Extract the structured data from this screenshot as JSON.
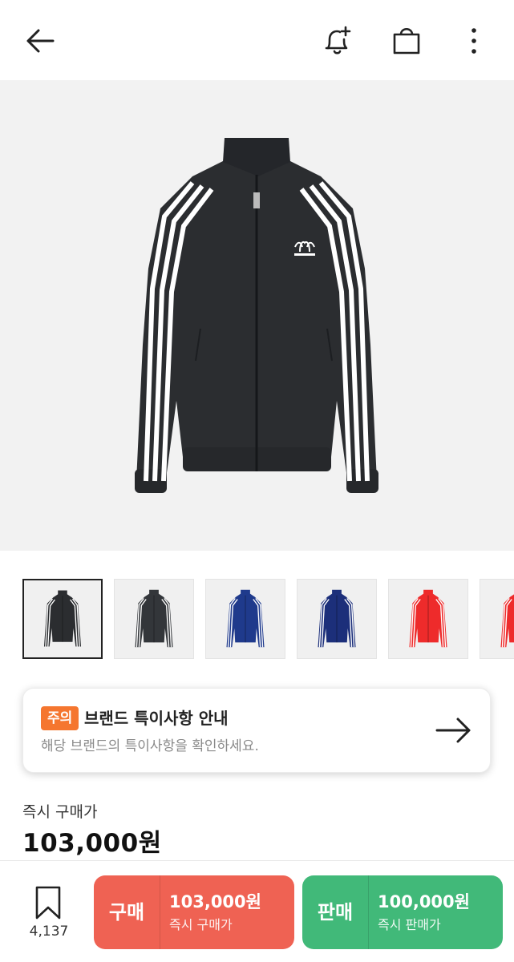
{
  "header": {
    "back_icon": "arrow-left-icon",
    "alert_icon": "bell-plus-icon",
    "cart_icon": "shopping-bag-icon",
    "more_icon": "more-vertical-icon"
  },
  "product_image": {
    "color": "#2b2d30",
    "stripe_color": "#ffffff",
    "background": "#f2f2f2"
  },
  "thumbnails": [
    {
      "color": "#2b2d30",
      "selected": true
    },
    {
      "color": "#33363a",
      "selected": false
    },
    {
      "color": "#1f3a8c",
      "selected": false
    },
    {
      "color": "#1c2f7a",
      "selected": false
    },
    {
      "color": "#ee2b2b",
      "selected": false
    },
    {
      "color": "#ee2b2b",
      "selected": false
    }
  ],
  "notice": {
    "badge": "주의",
    "title": "브랜드 특이사항 안내",
    "description": "해당 브랜드의 특이사항을 확인하세요.",
    "arrow_icon": "arrow-right-icon"
  },
  "price": {
    "label": "즉시 구매가",
    "value": "103,000원"
  },
  "bottom_bar": {
    "bookmark_icon": "bookmark-icon",
    "bookmark_count": "4,137",
    "buy": {
      "label": "구매",
      "amount": "103,000원",
      "sub": "즉시 구매가",
      "color": "#ef6253"
    },
    "sell": {
      "label": "판매",
      "amount": "100,000원",
      "sub": "즉시 판매가",
      "color": "#41b979"
    }
  }
}
